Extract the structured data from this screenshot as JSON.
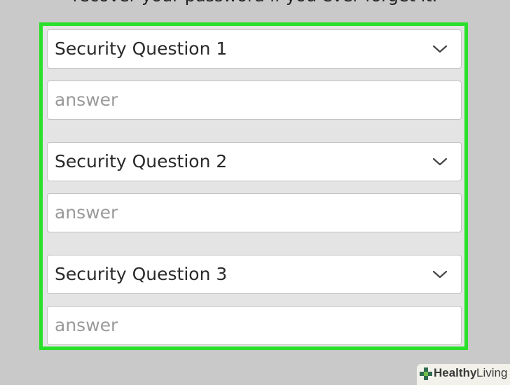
{
  "intro_text": "recover your password if you ever forget it.",
  "highlight_color": "#2ae02a",
  "form": {
    "rows": [
      {
        "question_label": "Security Question 1",
        "answer_placeholder": "answer"
      },
      {
        "question_label": "Security Question 2",
        "answer_placeholder": "answer"
      },
      {
        "question_label": "Security Question 3",
        "answer_placeholder": "answer"
      }
    ],
    "dropdown_icon": "chevron-down-icon"
  },
  "watermark": {
    "brand_bold": "Healthy",
    "brand_light": "Living",
    "icon": "plus-leaf-icon"
  }
}
